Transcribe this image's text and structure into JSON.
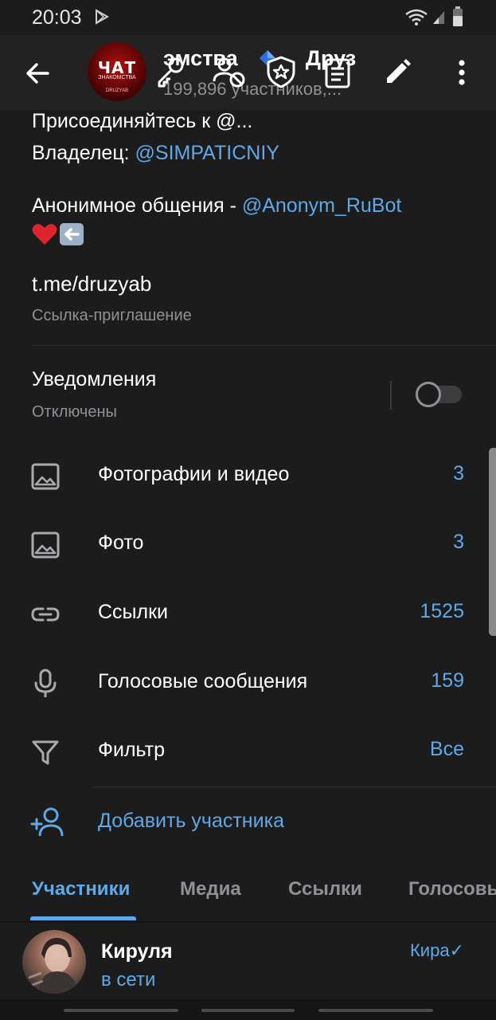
{
  "status_bar": {
    "time": "20:03"
  },
  "header": {
    "title": "эмства",
    "title_suffix": "Друз",
    "subtitle": "199,896 участников,...",
    "avatar": {
      "title": "ЧАТ",
      "sub": "ЗНАКОМСТВА",
      "brand": "DRUZYAB"
    }
  },
  "info": {
    "cut_line": "Присоединяйтесь к @...",
    "owner_label": "Владелец: ",
    "owner_link": "@SIMPATICNIY",
    "anon_label": "Анонимное общения  - ",
    "anon_link": "@Anonym_RuBot",
    "invite_link": "t.me/druzyab",
    "invite_caption": "Ссылка-приглашение"
  },
  "notifications": {
    "label": "Уведомления",
    "status": "Отключены",
    "enabled": false
  },
  "media_rows": [
    {
      "icon": "image-icon",
      "label": "Фотографии и видео",
      "count": "3"
    },
    {
      "icon": "image-icon",
      "label": "Фото",
      "count": "3"
    },
    {
      "icon": "link-icon",
      "label": "Ссылки",
      "count": "1525"
    },
    {
      "icon": "microphone-icon",
      "label": "Голосовые сообщения",
      "count": "159"
    },
    {
      "icon": "filter-icon",
      "label": "Фильтр",
      "count": "Все"
    }
  ],
  "add_member": {
    "label": "Добавить участника"
  },
  "tabs": [
    {
      "label": "Участники",
      "active": true
    },
    {
      "label": "Медиа",
      "active": false
    },
    {
      "label": "Ссылки",
      "active": false
    },
    {
      "label": "Голосовые",
      "active": false
    }
  ],
  "member": {
    "name": "Кируля",
    "status": "в сети",
    "tag": "Кира✓"
  },
  "colors": {
    "accent": "#5fa9e8",
    "background": "#1c1c1d",
    "header": "#222223",
    "secondary_text": "#8e9196"
  }
}
